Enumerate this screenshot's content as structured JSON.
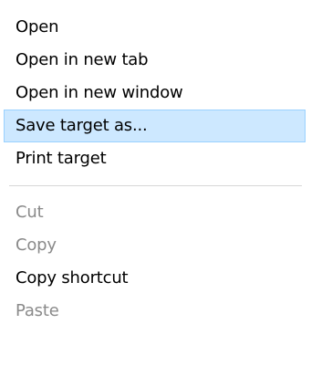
{
  "menu": {
    "group1": [
      {
        "label": "Open"
      },
      {
        "label": "Open in new tab"
      },
      {
        "label": "Open in new window"
      },
      {
        "label": "Save target as..."
      },
      {
        "label": "Print target"
      }
    ],
    "group2": [
      {
        "label": "Cut"
      },
      {
        "label": "Copy"
      },
      {
        "label": "Copy shortcut"
      },
      {
        "label": "Paste"
      }
    ]
  },
  "colors": {
    "highlight_background": "#cde8ff",
    "highlight_border": "#99d1ff",
    "disabled_text": "#8a8a8a",
    "separator": "#d7d7d7"
  }
}
